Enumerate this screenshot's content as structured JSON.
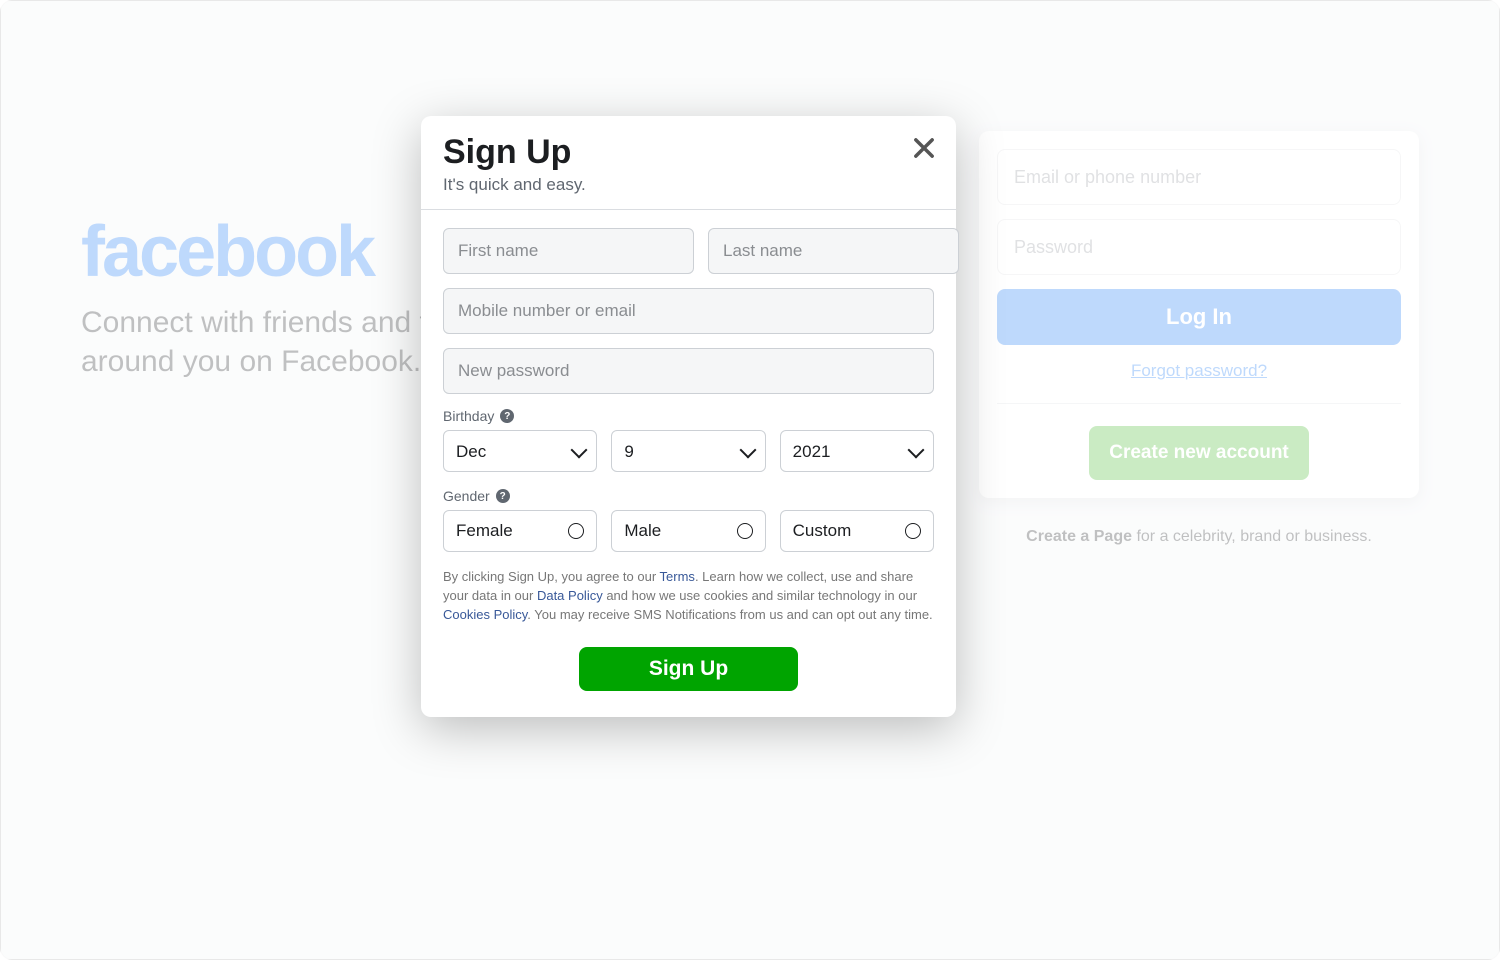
{
  "bg": {
    "logo": "facebook",
    "tagline": "Connect with friends and the world around you on Facebook.",
    "email_placeholder": "Email or phone number",
    "password_placeholder": "Password",
    "login_label": "Log In",
    "forgot_label": "Forgot password?",
    "create_label": "Create new account",
    "page_text_prefix": "Create a Page",
    "page_text_suffix": " for a celebrity, brand or business."
  },
  "modal": {
    "title": "Sign Up",
    "subtitle": "It's quick and easy.",
    "first_name_placeholder": "First name",
    "last_name_placeholder": "Last name",
    "contact_placeholder": "Mobile number or email",
    "password_placeholder": "New password",
    "birthday_label": "Birthday",
    "birthday": {
      "month": "Dec",
      "day": "9",
      "year": "2021"
    },
    "gender_label": "Gender",
    "gender": {
      "female": "Female",
      "male": "Male",
      "custom": "Custom"
    },
    "legal": {
      "t1": "By clicking Sign Up, you agree to our ",
      "terms": "Terms",
      "t2": ". Learn how we collect, use and share your data in our ",
      "data_policy": "Data Policy",
      "t3": " and how we use cookies and similar technology in our ",
      "cookies_policy": "Cookies Policy",
      "t4": ". You may receive SMS Notifications from us and can opt out any time."
    },
    "submit_label": "Sign Up"
  }
}
